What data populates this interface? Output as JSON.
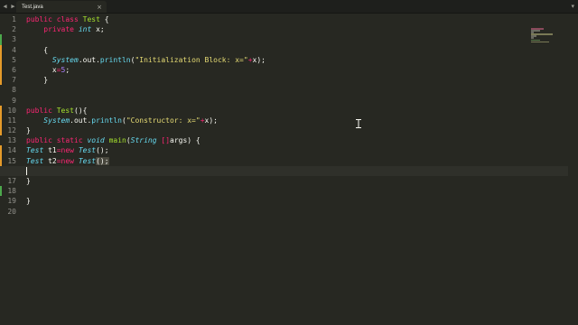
{
  "tab": {
    "title": "Test.java",
    "close_glyph": "×"
  },
  "nav": {
    "back_glyph": "◀",
    "forward_glyph": "▶"
  },
  "tab_menu_glyph": "▾",
  "gutter": {
    "line_numbers": [
      "1",
      "2",
      "3",
      "4",
      "5",
      "6",
      "7",
      "8",
      "9",
      "10",
      "11",
      "12",
      "13",
      "14",
      "15",
      "16",
      "17",
      "18",
      "19",
      "20"
    ],
    "markers": [
      "",
      "",
      "added",
      "modified",
      "modified",
      "modified",
      "modified",
      "",
      "",
      "modified",
      "modified",
      "modified",
      "",
      "modified",
      "modified",
      "added",
      "",
      "added",
      "",
      ""
    ],
    "current_line": 16
  },
  "code_lines": [
    "public class Test {",
    "    private int x;",
    "",
    "    {",
    "      System.out.println(\"Initialization Block: x=\"+x);",
    "      x=5;",
    "    }",
    "",
    "",
    "public Test(){",
    "    System.out.println(\"Constructor: x=\"+x);",
    "}",
    "public static void main(String []args) {",
    "Test t1=new Test();",
    "Test t2=new Test();",
    "",
    "}",
    "",
    "}",
    ""
  ],
  "colors": {
    "background": "#272822",
    "keyword": "#f92672",
    "type": "#66d9ef",
    "class_name": "#a6e22e",
    "string": "#e6db74",
    "number": "#ae81ff",
    "modified_marker": "#e59b2a",
    "added_marker": "#4ca84c"
  },
  "icons": {
    "mouse_cursor": "text-cursor-icon"
  }
}
